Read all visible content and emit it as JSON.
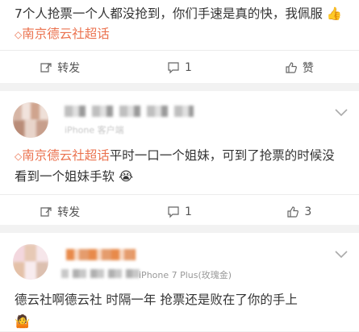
{
  "posts": [
    {
      "text_parts": [
        "7个人抢票一个人都没抢到，你们手速是真的快，我佩服",
        "南京德云社超话",
        ""
      ],
      "emoji_thumb": "👍",
      "topic_icon": "◇",
      "actions": {
        "repost_label": "转发",
        "comment_count": "1",
        "like_label": "赞"
      }
    },
    {
      "meta_text": "iPhone 客户端",
      "text_parts": [
        "",
        "南京德云社超话",
        "平时一口一个姐妹，可到了抢票的时候没看到一个姐妹手软"
      ],
      "emoji": "😭",
      "topic_icon": "◇",
      "actions": {
        "repost_label": "转发",
        "comment_count": "1",
        "like_count": "3"
      }
    },
    {
      "meta_text": "iPhone 7 Plus(玫瑰金)",
      "text_parts": [
        "德云社啊德云社 时隔一年 抢票还是败在了你的手上",
        "",
        ""
      ],
      "emoji": "🤷"
    }
  ],
  "colors": {
    "accent": "#eb7350",
    "text": "#333333",
    "muted": "#999999",
    "bg": "#f2f2f2"
  }
}
